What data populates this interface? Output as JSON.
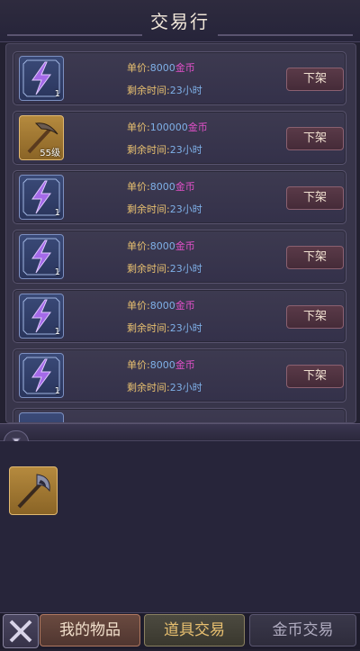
{
  "header": {
    "title": "交易行"
  },
  "listing_labels": {
    "price_prefix": "单价:",
    "time_prefix": "剩余时间:",
    "currency": "金币",
    "delist": "下架"
  },
  "listings": [
    {
      "item_icon": "lightning-icon",
      "badge": "1",
      "price": "8000",
      "time": "23小时",
      "rarity_color": "#3a4a78"
    },
    {
      "item_icon": "pickaxe-icon",
      "badge": "55级",
      "price": "100000",
      "time": "23小时",
      "rarity_color": "#b58a3e"
    },
    {
      "item_icon": "lightning-icon",
      "badge": "1",
      "price": "8000",
      "time": "23小时",
      "rarity_color": "#3a4a78"
    },
    {
      "item_icon": "lightning-icon",
      "badge": "1",
      "price": "8000",
      "time": "23小时",
      "rarity_color": "#3a4a78"
    },
    {
      "item_icon": "lightning-icon",
      "badge": "1",
      "price": "8000",
      "time": "23小时",
      "rarity_color": "#3a4a78"
    },
    {
      "item_icon": "lightning-icon",
      "badge": "1",
      "price": "8000",
      "time": "23小时",
      "rarity_color": "#3a4a78"
    }
  ],
  "inventory": {
    "bag_icon": "bag-icon",
    "items": [
      {
        "item_icon": "axe-icon",
        "rarity_color": "#b58a3e"
      }
    ]
  },
  "bottom_bar": {
    "close_icon": "close-icon",
    "tabs": [
      {
        "label": "我的物品",
        "state": "active"
      },
      {
        "label": "道具交易",
        "state": "normal"
      },
      {
        "label": "金币交易",
        "state": "dim"
      }
    ]
  },
  "colors": {
    "accent_gold": "#e8c070",
    "price_blue": "#7fb0e8",
    "currency_pink": "#e050c8"
  }
}
